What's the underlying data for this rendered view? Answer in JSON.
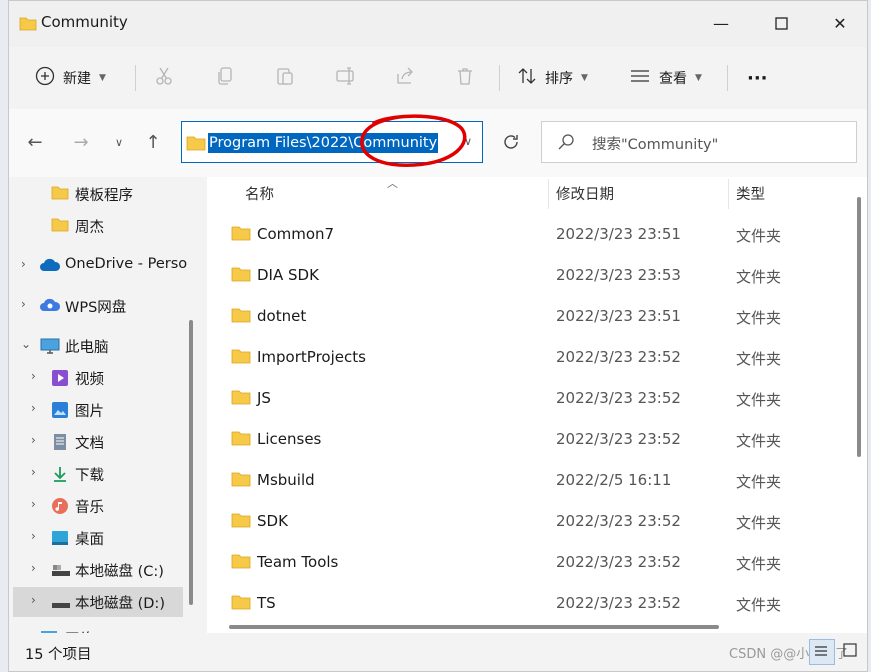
{
  "window": {
    "title": "Community"
  },
  "toolbar": {
    "new_label": "新建",
    "sort_label": "排序",
    "view_label": "查看",
    "more_label": "···"
  },
  "address": {
    "path": "Program Files\\2022\\Community",
    "search_placeholder": "搜索\"Community\""
  },
  "nav": {
    "items": [
      {
        "label": "模板程序"
      },
      {
        "label": "周杰"
      },
      {
        "label": "OneDrive - Perso"
      },
      {
        "label": "WPS网盘"
      },
      {
        "label": "此电脑"
      },
      {
        "label": "视频"
      },
      {
        "label": "图片"
      },
      {
        "label": "文档"
      },
      {
        "label": "下载"
      },
      {
        "label": "音乐"
      },
      {
        "label": "桌面"
      },
      {
        "label": "本地磁盘 (C:)"
      },
      {
        "label": "本地磁盘 (D:)"
      },
      {
        "label": "网络"
      }
    ]
  },
  "columns": {
    "name": "名称",
    "date": "修改日期",
    "type": "类型"
  },
  "files": [
    {
      "name": "Common7",
      "date": "2022/3/23 23:51",
      "type": "文件夹"
    },
    {
      "name": "DIA SDK",
      "date": "2022/3/23 23:53",
      "type": "文件夹"
    },
    {
      "name": "dotnet",
      "date": "2022/3/23 23:51",
      "type": "文件夹"
    },
    {
      "name": "ImportProjects",
      "date": "2022/3/23 23:52",
      "type": "文件夹"
    },
    {
      "name": "JS",
      "date": "2022/3/23 23:52",
      "type": "文件夹"
    },
    {
      "name": "Licenses",
      "date": "2022/3/23 23:52",
      "type": "文件夹"
    },
    {
      "name": "Msbuild",
      "date": "2022/2/5 16:11",
      "type": "文件夹"
    },
    {
      "name": "SDK",
      "date": "2022/3/23 23:52",
      "type": "文件夹"
    },
    {
      "name": "Team Tools",
      "date": "2022/3/23 23:52",
      "type": "文件夹"
    },
    {
      "name": "TS",
      "date": "2022/3/23 23:52",
      "type": "文件夹"
    }
  ],
  "status": {
    "count": "15 个项目",
    "watermark": "CSDN @@小木不了"
  },
  "colors": {
    "accent": "#0067c0",
    "folder": "#f7c948",
    "annotation": "#e00000"
  }
}
